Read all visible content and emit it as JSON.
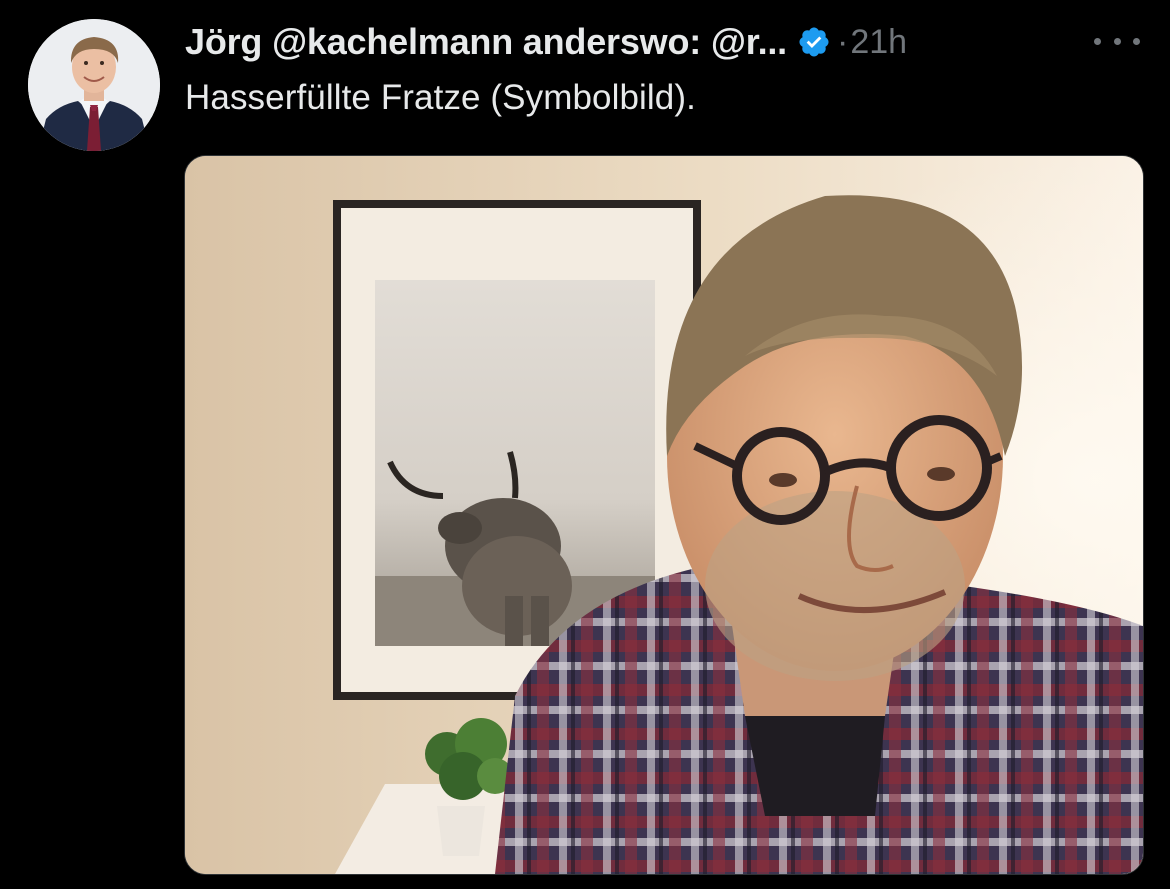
{
  "tweet": {
    "author": {
      "display_name": "Jörg @kachelmann anderswo: @r...",
      "verified": true
    },
    "separator": "·",
    "timestamp": "21h",
    "text": "Hasserfüllte Fratze (Symbolbild).",
    "media": {
      "type": "photo"
    }
  },
  "icons": {
    "verified": "verified-badge-icon",
    "more": "more-horizontal-icon"
  },
  "colors": {
    "background": "#000000",
    "text_primary": "#e7e9ea",
    "text_secondary": "#71767b",
    "verified_blue": "#1d9bf0"
  }
}
